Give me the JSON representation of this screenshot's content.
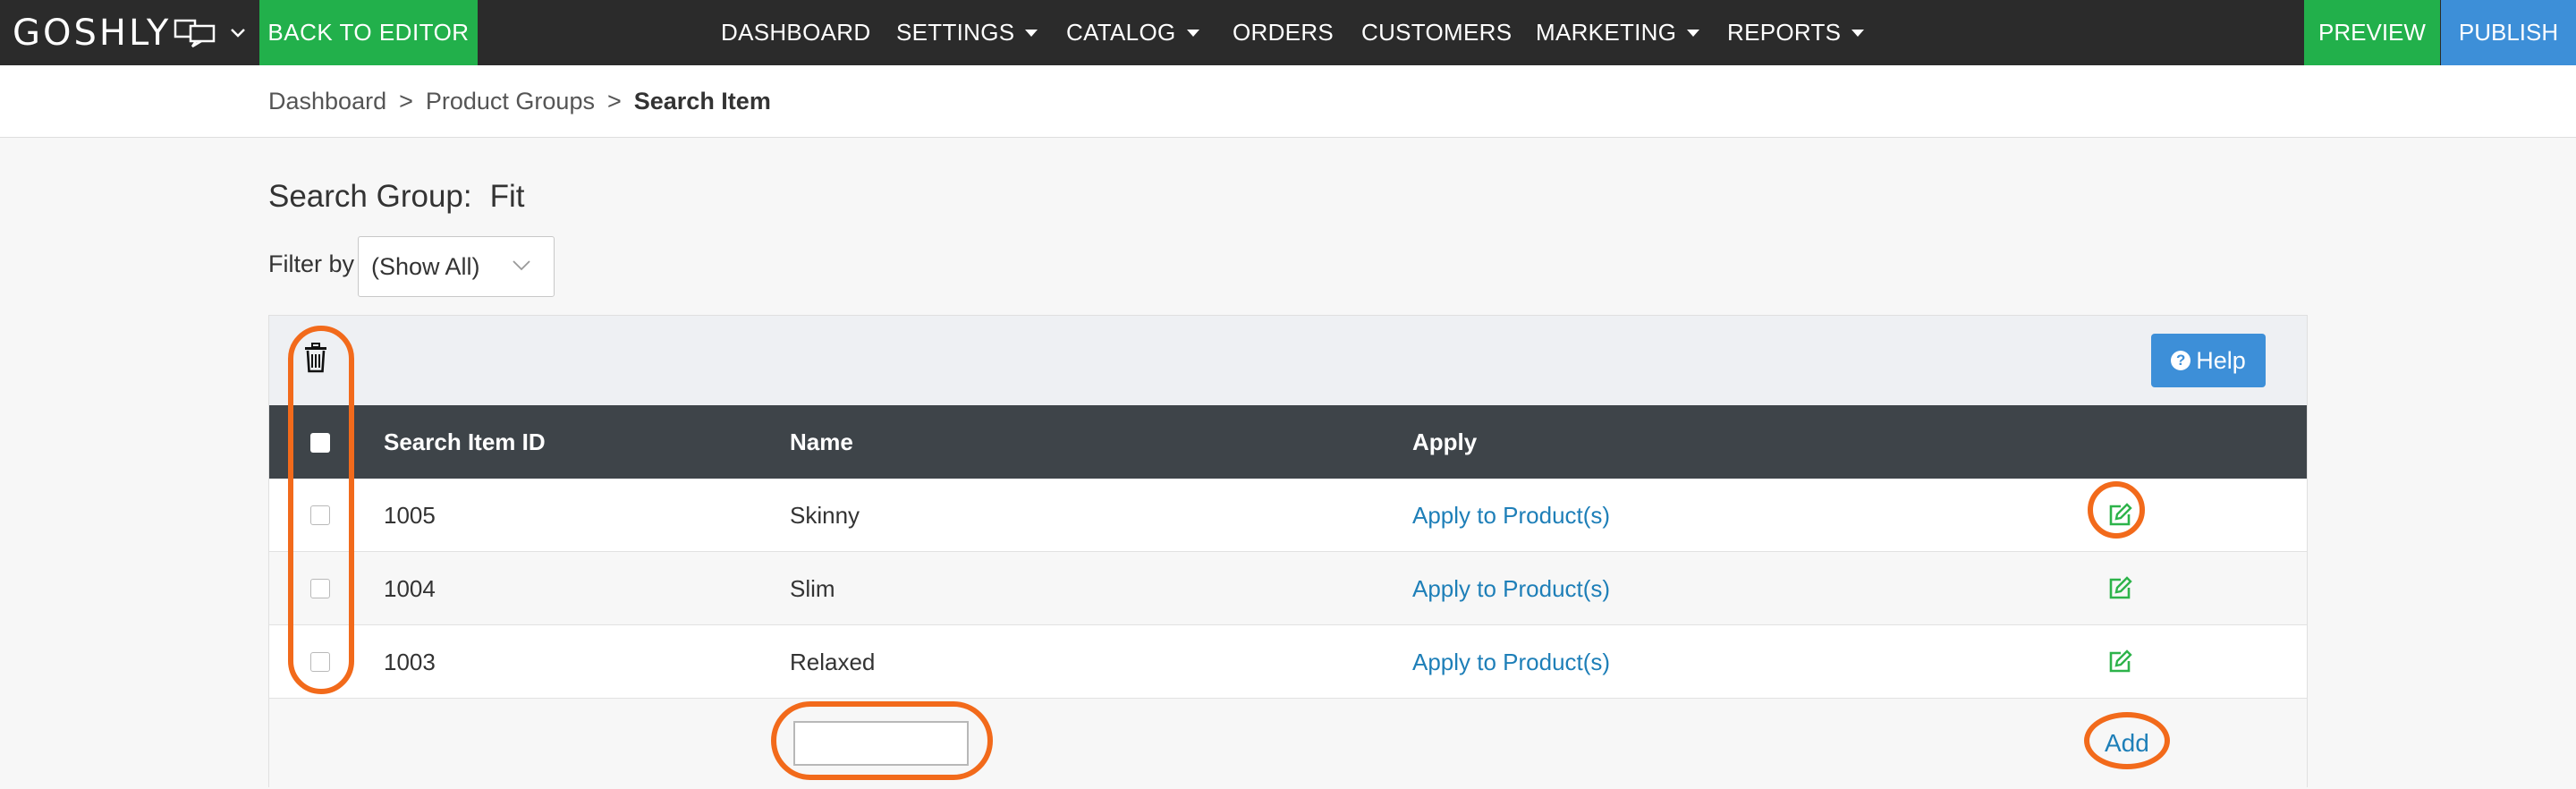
{
  "topbar": {
    "logo": "GOSHLY",
    "back_to_editor": "BACK TO EDITOR",
    "nav": [
      {
        "label": "DASHBOARD",
        "has_menu": false
      },
      {
        "label": "SETTINGS",
        "has_menu": true
      },
      {
        "label": "CATALOG",
        "has_menu": true
      },
      {
        "label": "ORDERS",
        "has_menu": false
      },
      {
        "label": "CUSTOMERS",
        "has_menu": false
      },
      {
        "label": "MARKETING",
        "has_menu": true
      },
      {
        "label": "REPORTS",
        "has_menu": true
      }
    ],
    "preview": "PREVIEW",
    "publish": "PUBLISH"
  },
  "breadcrumb": {
    "items": [
      "Dashboard",
      "Product Groups"
    ],
    "separator": ">",
    "current": "Search Item"
  },
  "header": {
    "group_label": "Search Group:",
    "group_value": "Fit",
    "filter_label": "Filter by",
    "filter_value": "(Show All)"
  },
  "toolbar": {
    "help_label": "Help",
    "help_icon": "question-circle-icon",
    "delete_icon": "trash-icon"
  },
  "table": {
    "columns": [
      "Search Item ID",
      "Name",
      "Apply"
    ],
    "rows": [
      {
        "id": "1005",
        "name": "Skinny",
        "apply": "Apply to Product(s)"
      },
      {
        "id": "1004",
        "name": "Slim",
        "apply": "Apply to Product(s)"
      },
      {
        "id": "1003",
        "name": "Relaxed",
        "apply": "Apply to Product(s)"
      }
    ],
    "new_name_value": "",
    "add_label": "Add"
  },
  "colors": {
    "topbar": "#2b2b2b",
    "green": "#22b04b",
    "blue": "#3d8fd8",
    "link": "#1e7fb8",
    "header_row": "#3e4449",
    "annotation": "#f26a1b"
  }
}
